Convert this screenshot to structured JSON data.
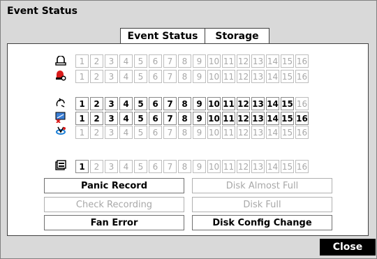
{
  "window": {
    "title": "Event Status"
  },
  "tabs": [
    {
      "label": "Event Status",
      "active": true
    },
    {
      "label": "Storage",
      "active": false
    }
  ],
  "grid": {
    "rows": [
      {
        "icon": "alarm-in-icon",
        "active": []
      },
      {
        "icon": "alarm-out-icon",
        "active": []
      },
      {
        "icon": "motion-icon",
        "active": [
          1,
          2,
          3,
          4,
          5,
          6,
          7,
          8,
          9,
          10,
          11,
          12,
          13,
          14,
          15
        ]
      },
      {
        "icon": "video-loss-icon",
        "active": [
          1,
          2,
          3,
          4,
          5,
          6,
          7,
          8,
          9,
          10,
          11,
          12,
          13,
          14,
          15,
          16
        ]
      },
      {
        "icon": "text-in-icon",
        "active": []
      },
      {
        "icon": "record-icon",
        "active": [
          1
        ]
      }
    ],
    "channels": [
      "1",
      "2",
      "3",
      "4",
      "5",
      "6",
      "7",
      "8",
      "9",
      "10",
      "11",
      "12",
      "13",
      "14",
      "15",
      "16"
    ]
  },
  "status_buttons": [
    {
      "label": "Panic Record",
      "enabled": true
    },
    {
      "label": "Disk Almost Full",
      "enabled": false
    },
    {
      "label": "Check Recording",
      "enabled": false
    },
    {
      "label": "Disk Full",
      "enabled": false
    },
    {
      "label": "Fan Error",
      "enabled": true
    },
    {
      "label": "Disk Config Change",
      "enabled": true
    }
  ],
  "footer": {
    "close_label": "Close"
  }
}
